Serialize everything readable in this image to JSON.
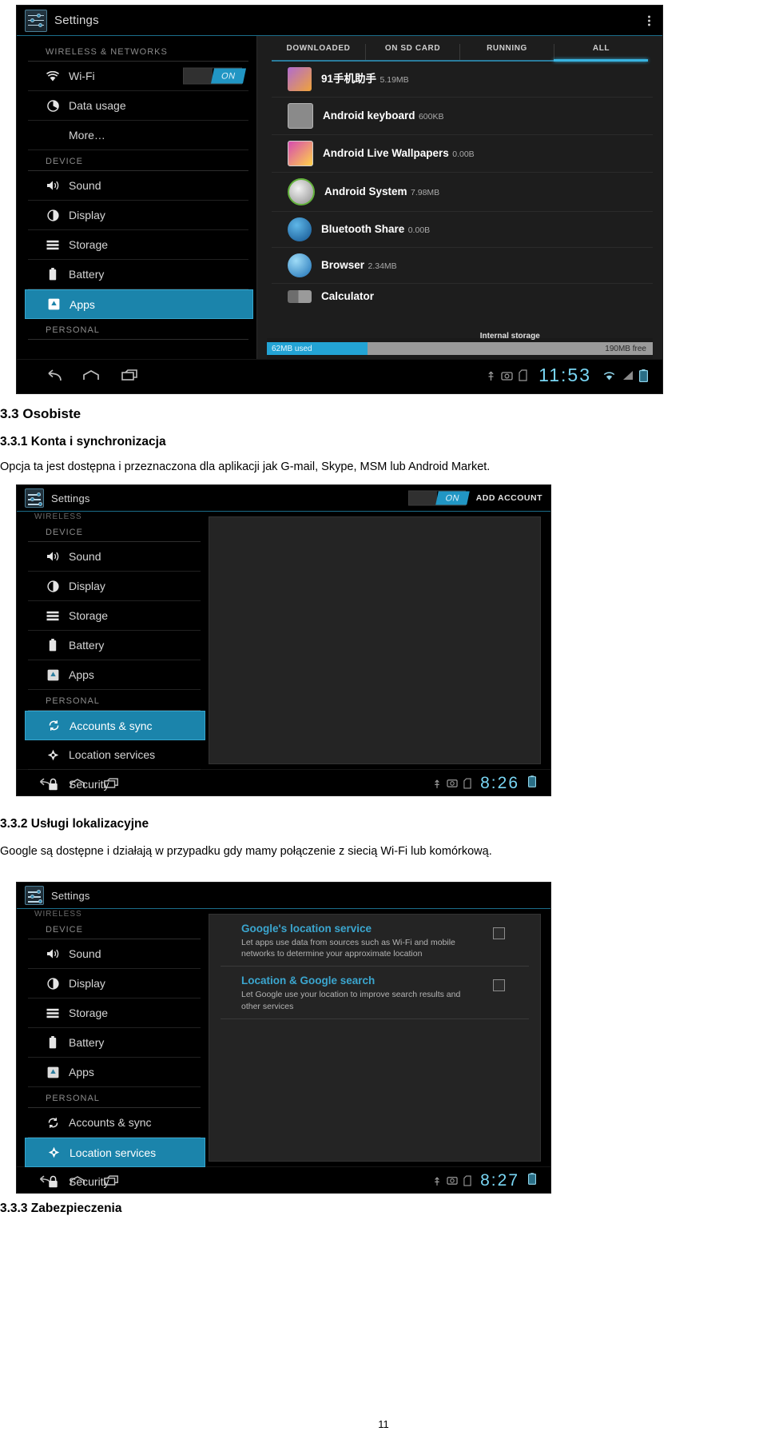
{
  "document": {
    "page_number": "11",
    "sections": [
      {
        "id": "s33",
        "heading": "3.3 Osobiste"
      },
      {
        "id": "s331",
        "heading": "3.3.1 Konta i synchronizacja",
        "body": "Opcja ta jest dostępna i przeznaczona dla aplikacji jak G-mail, Skype, MSM lub Android Market."
      },
      {
        "id": "s332",
        "heading": "3.3.2 Usługi lokalizacyjne",
        "body": "Google są dostępne i działają w przypadku gdy mamy połączenie z siecią Wi-Fi lub komórkową."
      },
      {
        "id": "s333",
        "heading": "3.3.3 Zabezpieczenia"
      }
    ]
  },
  "screenshot_apps": {
    "title": "Settings",
    "overflow_icon": "overflow-menu-icon",
    "sidebar": {
      "groups": [
        {
          "label": "WIRELESS & NETWORKS",
          "items": [
            {
              "label": "Wi-Fi",
              "icon": "wifi-icon",
              "toggle": "ON",
              "selected": false
            },
            {
              "label": "Data usage",
              "icon": "data-usage-icon",
              "selected": false
            },
            {
              "label": "More…",
              "icon": "none",
              "selected": false
            }
          ]
        },
        {
          "label": "DEVICE",
          "items": [
            {
              "label": "Sound",
              "icon": "sound-icon",
              "selected": false
            },
            {
              "label": "Display",
              "icon": "display-icon",
              "selected": false
            },
            {
              "label": "Storage",
              "icon": "storage-icon",
              "selected": false
            },
            {
              "label": "Battery",
              "icon": "battery-icon",
              "selected": false
            },
            {
              "label": "Apps",
              "icon": "apps-icon",
              "selected": true
            }
          ]
        },
        {
          "label": "PERSONAL",
          "items": []
        }
      ]
    },
    "tabs": [
      {
        "label": "DOWNLOADED",
        "active": false
      },
      {
        "label": "ON SD CARD",
        "active": false
      },
      {
        "label": "RUNNING",
        "active": false
      },
      {
        "label": "ALL",
        "active": true
      }
    ],
    "apps": [
      {
        "name": "91手机助手",
        "size": "5.19MB",
        "icon": "app91-icon",
        "color": "#b06bd0"
      },
      {
        "name": "Android keyboard",
        "size": "600KB",
        "icon": "keyboard-icon",
        "color": "#8a8a8a"
      },
      {
        "name": "Android Live Wallpapers",
        "size": "0.00B",
        "icon": "wallpaper-icon",
        "color": "#d64bb0"
      },
      {
        "name": "Android System",
        "size": "7.98MB",
        "icon": "android-system-icon",
        "color": "#7ea84f"
      },
      {
        "name": "Bluetooth Share",
        "size": "0.00B",
        "icon": "bluetooth-icon",
        "color": "#1f7fc4"
      },
      {
        "name": "Browser",
        "size": "2.34MB",
        "icon": "browser-icon",
        "color": "#2f8fd6"
      },
      {
        "name": "Calculator",
        "size": "",
        "icon": "calculator-icon",
        "color": "#6d6d6d"
      }
    ],
    "storage": {
      "used_label": "62MB used",
      "center_label": "Internal storage",
      "free_label": "190MB free"
    },
    "systembar": {
      "clock": "11:53",
      "nav": [
        "back-icon",
        "home-icon",
        "recents-icon"
      ],
      "status": [
        "usb-icon",
        "screenshot-icon",
        "sdcard-icon",
        "wifi-signal-icon",
        "signal-icon",
        "battery-status-icon"
      ]
    }
  },
  "screenshot_accounts": {
    "title": "Settings",
    "toggle_label": "ON",
    "action_label": "ADD ACCOUNT",
    "sidebar": {
      "clipped_top": "WIRELESS",
      "groups": [
        {
          "label": "DEVICE",
          "items": [
            {
              "label": "Sound",
              "icon": "sound-icon",
              "selected": false
            },
            {
              "label": "Display",
              "icon": "display-icon",
              "selected": false
            },
            {
              "label": "Storage",
              "icon": "storage-icon",
              "selected": false
            },
            {
              "label": "Battery",
              "icon": "battery-icon",
              "selected": false
            },
            {
              "label": "Apps",
              "icon": "apps-icon",
              "selected": false
            }
          ]
        },
        {
          "label": "PERSONAL",
          "items": [
            {
              "label": "Accounts & sync",
              "icon": "sync-icon",
              "selected": true
            },
            {
              "label": "Location services",
              "icon": "location-icon",
              "selected": false
            },
            {
              "label": "Security",
              "icon": "lock-icon",
              "selected": false
            }
          ]
        }
      ]
    },
    "systembar": {
      "clock": "8:26",
      "nav": [
        "back-icon",
        "home-icon",
        "recents-icon"
      ],
      "status": [
        "usb-icon",
        "screenshot-icon",
        "sdcard-icon",
        "battery-status-icon"
      ]
    }
  },
  "screenshot_location": {
    "title": "Settings",
    "sidebar": {
      "clipped_top": "WIRELESS",
      "groups": [
        {
          "label": "DEVICE",
          "items": [
            {
              "label": "Sound",
              "icon": "sound-icon",
              "selected": false
            },
            {
              "label": "Display",
              "icon": "display-icon",
              "selected": false
            },
            {
              "label": "Storage",
              "icon": "storage-icon",
              "selected": false
            },
            {
              "label": "Battery",
              "icon": "battery-icon",
              "selected": false
            },
            {
              "label": "Apps",
              "icon": "apps-icon",
              "selected": false
            }
          ]
        },
        {
          "label": "PERSONAL",
          "items": [
            {
              "label": "Accounts & sync",
              "icon": "sync-icon",
              "selected": false
            },
            {
              "label": "Location services",
              "icon": "location-icon",
              "selected": true
            },
            {
              "label": "Security",
              "icon": "lock-icon",
              "selected": false
            }
          ]
        }
      ]
    },
    "options": [
      {
        "title": "Google's location service",
        "description": "Let apps use data from sources such as Wi-Fi and mobile networks to determine your approximate location",
        "checked": false
      },
      {
        "title": "Location & Google search",
        "description": "Let Google use your location to improve search results and other services",
        "checked": false
      }
    ],
    "systembar": {
      "clock": "8:27",
      "nav": [
        "back-icon",
        "home-icon",
        "recents-icon"
      ],
      "status": [
        "usb-icon",
        "screenshot-icon",
        "sdcard-icon",
        "battery-status-icon"
      ]
    }
  }
}
